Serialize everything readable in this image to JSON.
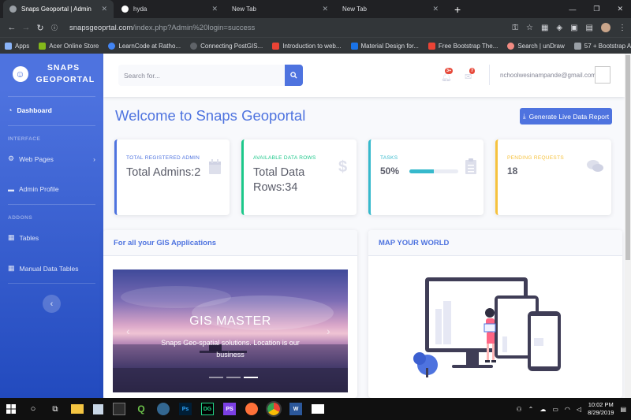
{
  "browser": {
    "tabs": [
      {
        "title": "Snaps Geoportal | Admin",
        "active": true
      },
      {
        "title": "hyda",
        "active": false
      },
      {
        "title": "New Tab",
        "active": false
      },
      {
        "title": "New Tab",
        "active": false
      }
    ],
    "url_host": "snapsgeoprtal.com",
    "url_path": "/index.php?Admin%20login=success",
    "bookmarks": [
      {
        "label": "Apps",
        "color": "#8ab4f8"
      },
      {
        "label": "Acer Online Store",
        "color": "#83b81a"
      },
      {
        "label": "LearnCode at Ratho...",
        "color": "#4285f4"
      },
      {
        "label": "Connecting PostGIS...",
        "color": "#5f6368"
      },
      {
        "label": "Introduction to web...",
        "color": "#ea4335"
      },
      {
        "label": "Material Design for...",
        "color": "#1a73e8"
      },
      {
        "label": "Free Bootstrap The...",
        "color": "#ea4335"
      },
      {
        "label": "Search | unDraw",
        "color": "#f28b82"
      },
      {
        "label": "57 + Bootstrap Ad...",
        "color": "#9aa0a6"
      }
    ]
  },
  "sidebar": {
    "brand": "SNAPS GEOPORTAL",
    "dashboard": "Dashboard",
    "heading_interface": "INTERFACE",
    "web_pages": "Web Pages",
    "admin_profile": "Admin Profile",
    "heading_addons": "ADDONS",
    "tables": "Tables",
    "manual_tables": "Manual Data Tables"
  },
  "topbar": {
    "search_placeholder": "Search for...",
    "alerts_badge": "3+",
    "messages_badge": "7",
    "user_email": "nchoolwesinampande@gmail.com"
  },
  "main": {
    "title": "Welcome to Snaps Geoportal",
    "report_button": "Generate Live Data Report",
    "cards": [
      {
        "label": "TOTAL REGISTERED ADMIN",
        "value": "Total Admins:2",
        "color": "#4e73df",
        "icon": "calendar-icon"
      },
      {
        "label": "AVAILABLE DATA ROWS",
        "value": "Total Data Rows:34",
        "color": "#1cc88a",
        "icon": "dollar-icon"
      },
      {
        "label": "TASKS",
        "value": "50%",
        "progress": 0.5,
        "color": "#36b9cc",
        "icon": "clipboard-icon"
      },
      {
        "label": "PENDING REQUESTS",
        "value": "18",
        "color": "#f6c23e",
        "icon": "comments-icon"
      }
    ],
    "panel_left_title": "For all your GIS Applications",
    "panel_right_title": "MAP YOUR WORLD",
    "carousel_title": "GIS MASTER",
    "carousel_caption": "Snaps Geo-spatial solutions. Location is our business"
  },
  "taskbar": {
    "time": "10:02 PM",
    "date": "8/29/2019"
  }
}
